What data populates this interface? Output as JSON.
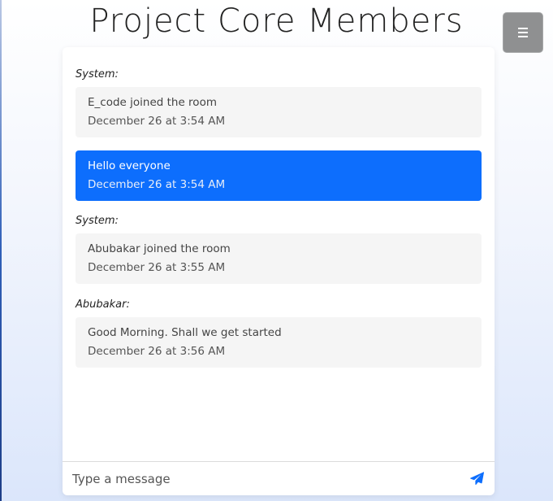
{
  "header": {
    "title": "Project Core Members"
  },
  "menu": {
    "icon": "hamburger-menu-icon"
  },
  "messages": [
    {
      "sender": "System:",
      "text": "E_code joined the room",
      "time": "December 26 at 3:54 AM",
      "own": false
    },
    {
      "sender": "",
      "text": "Hello everyone",
      "time": "December 26 at 3:54 AM",
      "own": true
    },
    {
      "sender": "System:",
      "text": "Abubakar joined the room",
      "time": "December 26 at 3:55 AM",
      "own": false
    },
    {
      "sender": "Abubakar:",
      "text": "Good Morning. Shall we get started",
      "time": "December 26 at 3:56 AM",
      "own": false
    }
  ],
  "composer": {
    "placeholder": "Type a message",
    "value": "",
    "send_icon": "paper-plane-icon"
  },
  "colors": {
    "own_bubble": "#0d6efd",
    "other_bubble": "#f5f5f5",
    "send_icon": "#0d6efd",
    "menu_button": "#8f9091"
  }
}
